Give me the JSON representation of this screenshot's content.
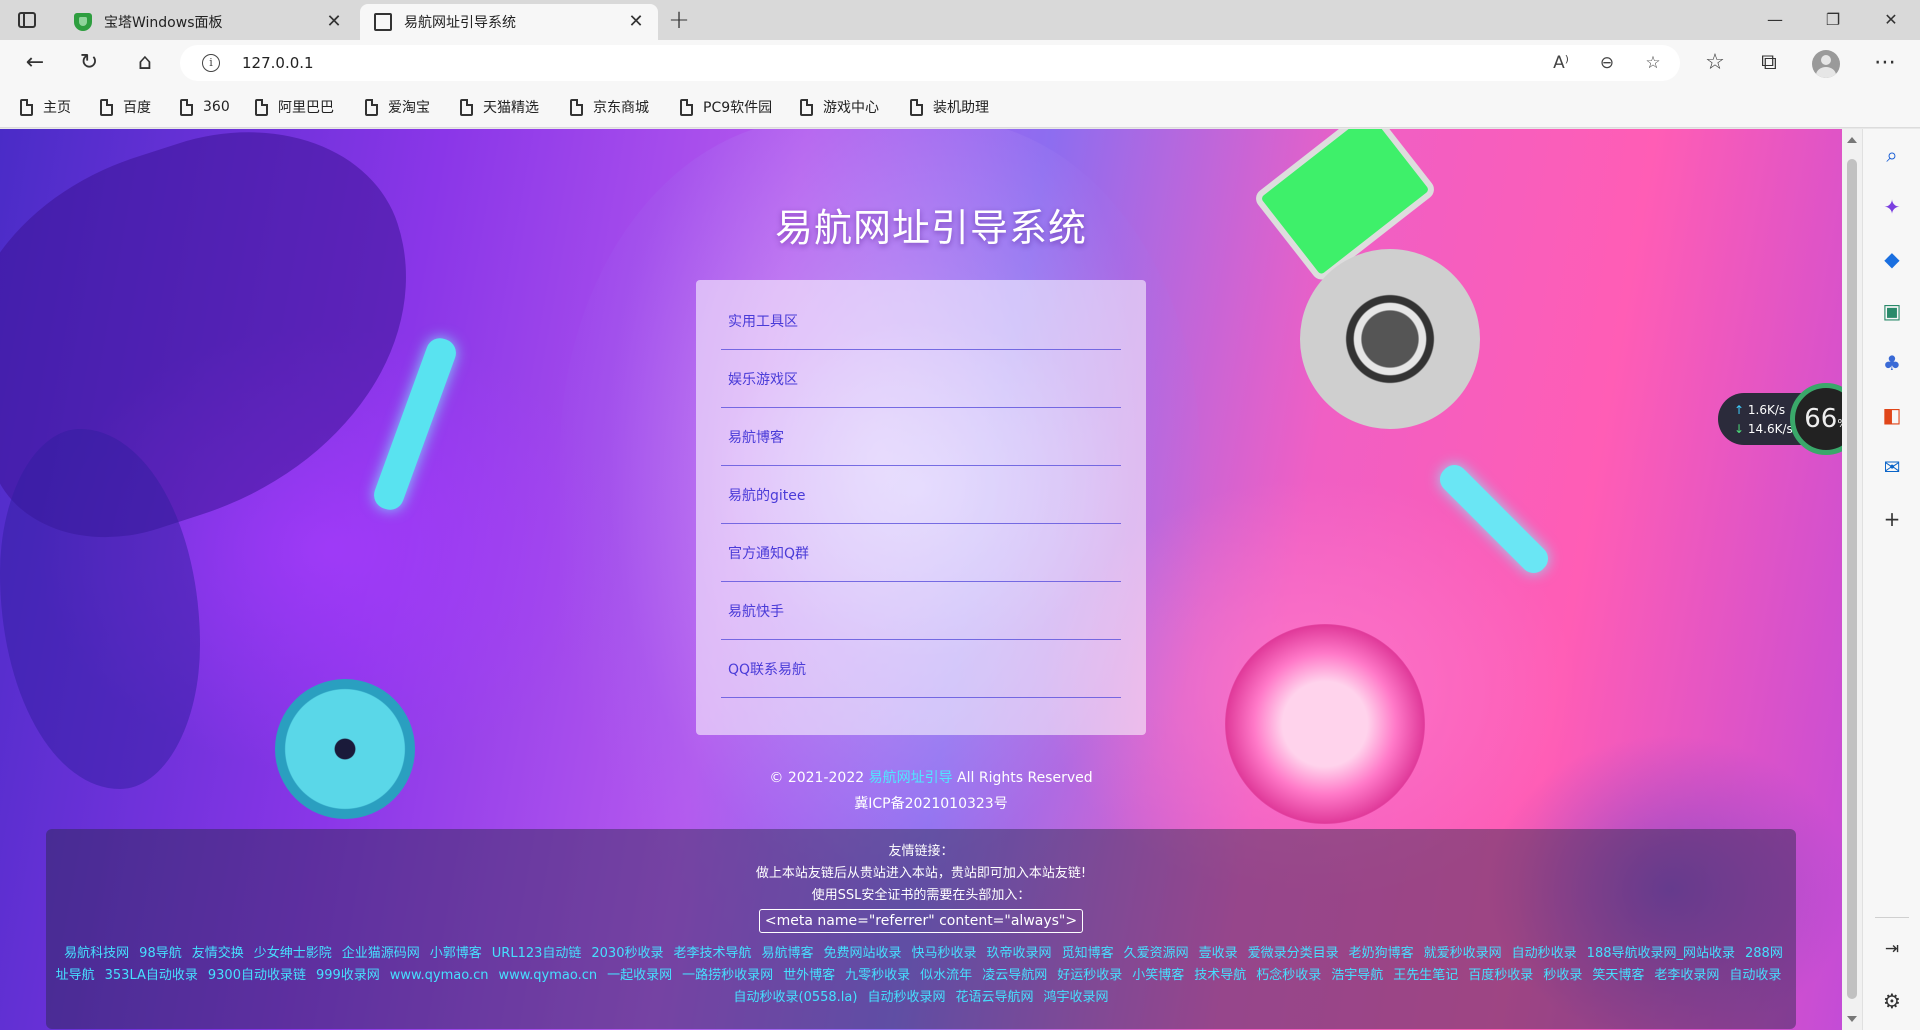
{
  "tabs": [
    {
      "title": "宝塔Windows面板",
      "active": false
    },
    {
      "title": "易航网址引导系统",
      "active": true
    }
  ],
  "window": {
    "minimize": "—",
    "maximize": "❐",
    "close": "✕",
    "new_tab": "+",
    "tab_close": "✕"
  },
  "toolbar": {
    "back": "←",
    "refresh": "↻",
    "home": "⌂",
    "url": "127.0.0.1",
    "read_aloud": "A⁾",
    "zoom": "⊖",
    "favorite_add": "☆",
    "favorites": "☆",
    "collections": "⧉",
    "menu": "⋯"
  },
  "bookmarks": [
    "主页",
    "百度",
    "360",
    "阿里巴巴",
    "爱淘宝",
    "天猫精选",
    "京东商城",
    "PC9软件园",
    "游戏中心",
    "装机助理"
  ],
  "page": {
    "title": "易航网址引导系统",
    "nav_items": [
      "实用工具区",
      "娱乐游戏区",
      "易航博客",
      "易航的gitee",
      "官方通知Q群",
      "易航快手",
      "QQ联系易航"
    ],
    "copyright_prefix": "© 2021-2022",
    "copyright_link": "易航网址引导",
    "copyright_suffix": "All Rights Reserved",
    "icp": "冀ICP备2021010323号",
    "friends_title": "友情链接：",
    "friends_line1": "做上本站友链后从贵站进入本站，贵站即可加入本站友链!",
    "friends_line2": "使用SSL安全证书的需要在头部加入：",
    "friends_code": "<meta name=\"referrer\" content=\"always\">",
    "friend_links": [
      "易航科技网",
      "98导航",
      "友情交换",
      "少女绅士影院",
      "企业猫源码网",
      "小郭博客",
      "URL123自动链",
      "2030秒收录",
      "老李技术导航",
      "易航博客",
      "免费网站收录",
      "快马秒收录",
      "玖帝收录网",
      "觅知博客",
      "久爱资源网",
      "壹收录",
      "爱微录分类目录",
      "老奶狗博客",
      "就爱秒收录网",
      "自动秒收录",
      "188导航收录网_网站收录",
      "288网址导航",
      "353LA自动收录",
      "9300自动收录链",
      "999收录网",
      "www.qymao.cn",
      "www.qymao.cn",
      "一起收录网",
      "一路捞秒收录网",
      "世外博客",
      "九零秒收录",
      "似水流年",
      "凌云导航网",
      "好运秒收录",
      "小笑博客",
      "技术导航",
      "朽念秒收录",
      "浩宇导航",
      "王先生笔记",
      "百度秒收录",
      "秒收录",
      "笑天博客",
      "老李收录网",
      "自动收录",
      "自动秒收录(0558.la)",
      "自动秒收录网",
      "花语云导航网",
      "鸿宇收录网"
    ]
  },
  "net_widget": {
    "upload": "1.6K/s",
    "download": "14.6K/s",
    "percent": "66",
    "percent_unit": "%"
  },
  "sidebar": [
    "search",
    "copilot",
    "shopping",
    "tools",
    "games",
    "office",
    "outlook",
    "add",
    "split-screen",
    "settings"
  ],
  "colors": {
    "accent_link": "#46e0ff",
    "panel_link": "#4a3bd8",
    "tab_active": "#f7f7f7",
    "tab_strip": "#d9d9d9"
  }
}
